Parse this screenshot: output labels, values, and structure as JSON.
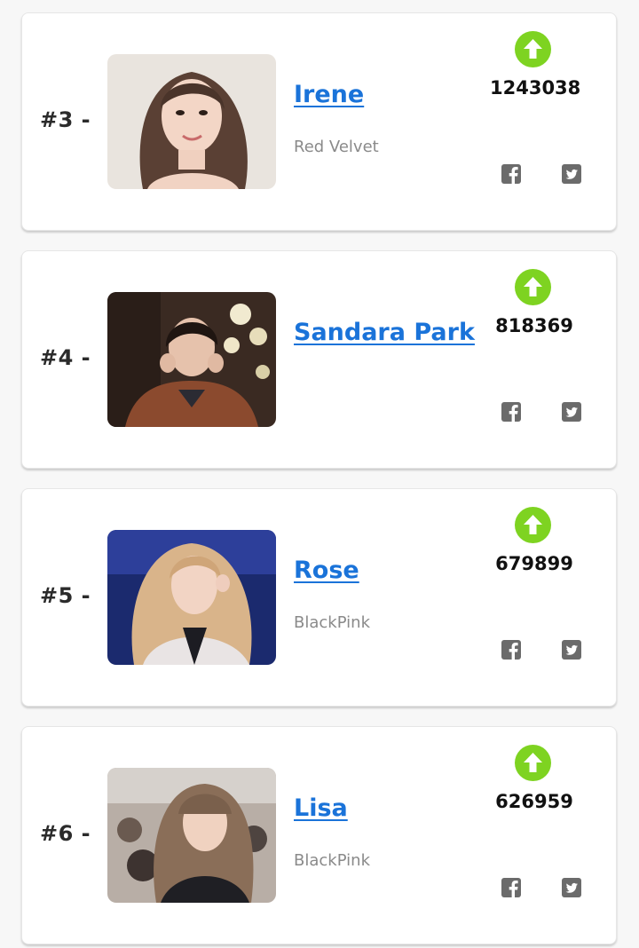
{
  "colors": {
    "accent_link": "#1a73d9",
    "upvote_green": "#7ed321",
    "icon_gray": "#6b6b6b"
  },
  "entries": [
    {
      "rank_label": "#3 -",
      "name": "Irene",
      "group": "Red Velvet",
      "votes": "1243038",
      "photo_icon": "portrait-photo",
      "upvote_icon": "arrow-up-icon",
      "share_icons": [
        "facebook-icon",
        "twitter-icon"
      ]
    },
    {
      "rank_label": "#4 -",
      "name": "Sandara Park",
      "group": "",
      "votes": "818369",
      "photo_icon": "portrait-photo",
      "upvote_icon": "arrow-up-icon",
      "share_icons": [
        "facebook-icon",
        "twitter-icon"
      ]
    },
    {
      "rank_label": "#5 -",
      "name": "Rose",
      "group": "BlackPink",
      "votes": "679899",
      "photo_icon": "portrait-photo",
      "upvote_icon": "arrow-up-icon",
      "share_icons": [
        "facebook-icon",
        "twitter-icon"
      ]
    },
    {
      "rank_label": "#6 -",
      "name": "Lisa",
      "group": "BlackPink",
      "votes": "626959",
      "photo_icon": "portrait-photo",
      "upvote_icon": "arrow-up-icon",
      "share_icons": [
        "facebook-icon",
        "twitter-icon"
      ]
    }
  ]
}
